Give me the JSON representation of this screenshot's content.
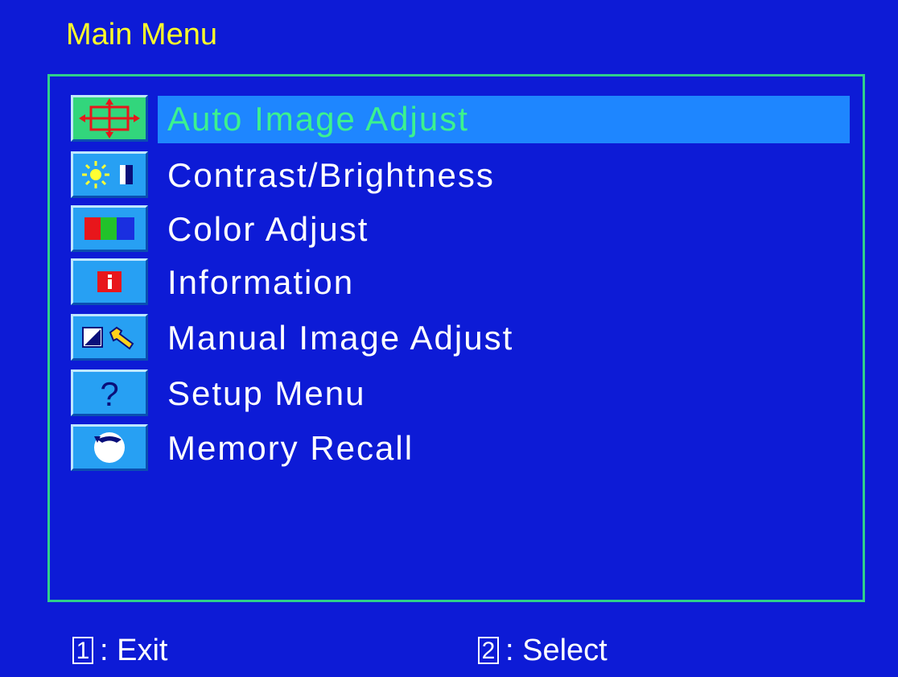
{
  "menu_title": "Main Menu",
  "menu": {
    "items": [
      {
        "label": "Auto Image Adjust",
        "icon": "auto-adjust-icon",
        "selected": true
      },
      {
        "label": "Contrast/Brightness",
        "icon": "contrast-brightness-icon",
        "selected": false
      },
      {
        "label": "Color Adjust",
        "icon": "color-bars-icon",
        "selected": false
      },
      {
        "label": "Information",
        "icon": "info-icon",
        "selected": false
      },
      {
        "label": "Manual Image Adjust",
        "icon": "manual-adjust-icon",
        "selected": false
      },
      {
        "label": "Setup Menu",
        "icon": "question-icon",
        "selected": false
      },
      {
        "label": "Memory Recall",
        "icon": "memory-recall-icon",
        "selected": false
      }
    ]
  },
  "footer": {
    "exit": {
      "key": "1",
      "label": ": Exit"
    },
    "select": {
      "key": "2",
      "label": ": Select"
    }
  },
  "colors": {
    "background": "#0d1bd6",
    "title": "#ffff2a",
    "panel_border": "#2fd08b",
    "selected_label": "#3cf28f",
    "selected_highlight": "#1e86ff"
  }
}
